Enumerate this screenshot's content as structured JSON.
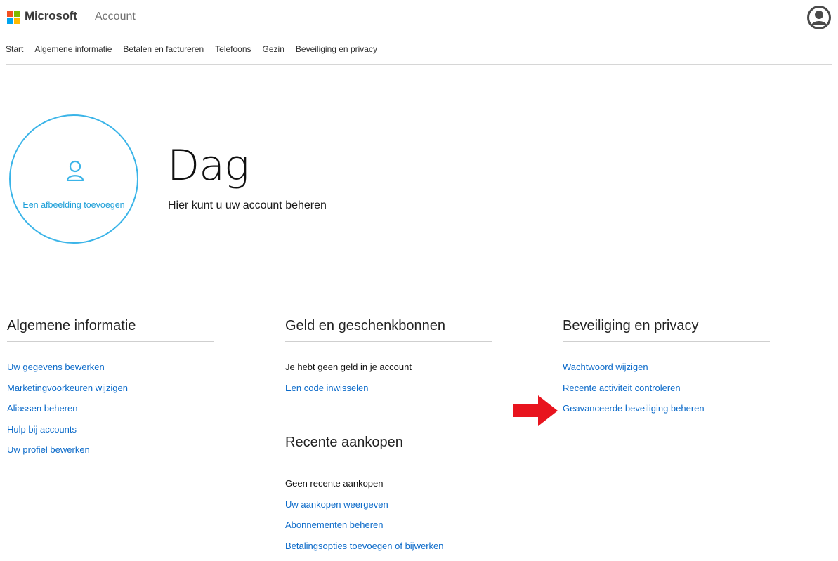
{
  "header": {
    "brand": "Microsoft",
    "section": "Account",
    "logo_colors": [
      "#f25022",
      "#7fba00",
      "#00a4ef",
      "#ffb900"
    ]
  },
  "nav": {
    "items": [
      "Start",
      "Algemene informatie",
      "Betalen en factureren",
      "Telefoons",
      "Gezin",
      "Beveiliging en privacy"
    ]
  },
  "profile": {
    "add_picture_label": "Een afbeelding toevoegen",
    "greeting": "Dag",
    "subtitle": "Hier kunt u uw account beheren"
  },
  "sections": {
    "general": {
      "title": "Algemene informatie",
      "links": [
        "Uw gegevens bewerken",
        "Marketingvoorkeuren wijzigen",
        "Aliassen beheren",
        "Hulp bij accounts",
        "Uw profiel bewerken"
      ]
    },
    "money": {
      "title": "Geld en geschenkbonnen",
      "status": "Je hebt geen geld in je account",
      "links": [
        "Een code inwisselen"
      ]
    },
    "purchases": {
      "title": "Recente aankopen",
      "status": "Geen recente aankopen",
      "links": [
        "Uw aankopen weergeven",
        "Abonnementen beheren",
        "Betalingsopties toevoegen of bijwerken"
      ]
    },
    "security": {
      "title": "Beveiliging en privacy",
      "links": [
        "Wachtwoord wijzigen",
        "Recente activiteit controleren",
        "Geavanceerde beveiliging beheren"
      ]
    }
  },
  "colors": {
    "accent": "#3ab4e8",
    "link": "#0b6ac9",
    "highlight_arrow": "#e8141e"
  }
}
